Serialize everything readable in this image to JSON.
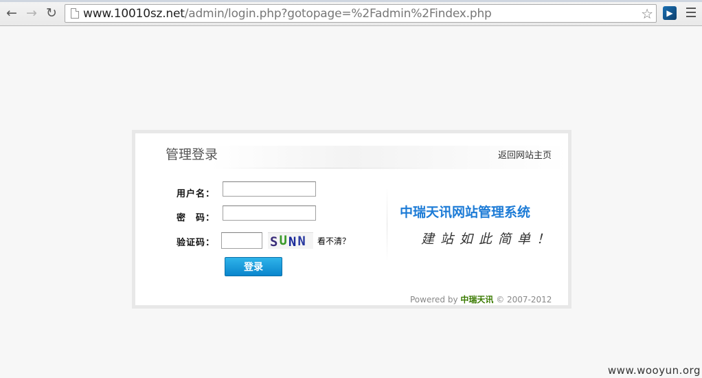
{
  "browser": {
    "url_host": "www.10010sz.net",
    "url_path": "/admin/login.php?gotopage=%2Fadmin%2Findex.php",
    "icons": {
      "back": "back-arrow-icon",
      "forward": "forward-arrow-icon",
      "reload": "reload-icon",
      "page": "page-icon",
      "bookmark": "star-icon",
      "extension": "extension-icon",
      "menu": "menu-icon"
    }
  },
  "login": {
    "title": "管理登录",
    "home_link": "返回网站主页",
    "username_label": "用户名：",
    "password_label": "密　码：",
    "captcha_label": "验证码：",
    "username_value": "",
    "password_value": "",
    "captcha_value": "",
    "captcha_image_text": [
      "S",
      "U",
      "N",
      "N"
    ],
    "refresh_captcha": "看不清？",
    "submit": "登录"
  },
  "brand": {
    "name": "中瑞天讯网站管理系统",
    "slogan": "建站如此简单！"
  },
  "footer": {
    "powered_by": "Powered by ",
    "company": "中瑞天讯",
    "copyright": " © 2007-2012"
  },
  "watermark": "www.wooyun.org",
  "colors": {
    "accent_blue": "#1c7bd6",
    "button_blue": "#0a85cc",
    "footer_brand_green": "#3a7a00",
    "captcha_letters": [
      "#3a2d7a",
      "#3a9a2a",
      "#1a2a9a",
      "#2a3aa0"
    ]
  }
}
